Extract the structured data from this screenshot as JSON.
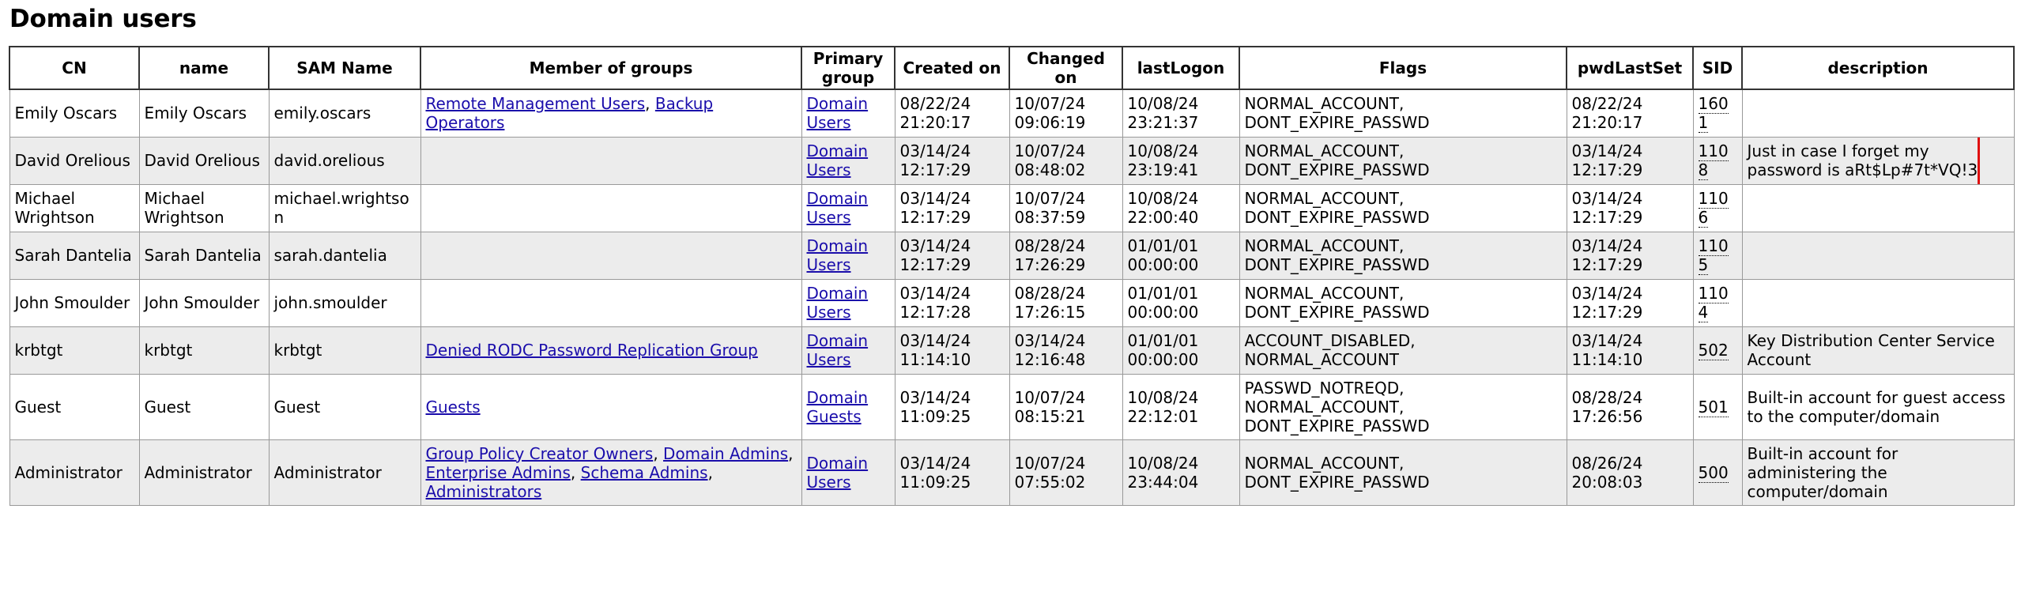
{
  "page": {
    "title": "Domain users"
  },
  "table": {
    "headers": {
      "cn": "CN",
      "name": "name",
      "sam": "SAM Name",
      "groups": "Member of groups",
      "primary": "Primary group",
      "created": "Created on",
      "changed": "Changed on",
      "lastlogon": "lastLogon",
      "flags": "Flags",
      "pwdlastset": "pwdLastSet",
      "sid": "SID",
      "description": "description"
    },
    "rows": [
      {
        "cn": "Emily Oscars",
        "name": "Emily Oscars",
        "sam": "emily.oscars",
        "groups": [
          "Remote Management Users",
          "Backup Operators"
        ],
        "primary": "Domain Users",
        "created": "08/22/24\n21:20:17",
        "changed": "10/07/24\n09:06:19",
        "lastlogon": "10/08/24\n23:21:37",
        "flags": "NORMAL_ACCOUNT,\nDONT_EXPIRE_PASSWD",
        "pwdlastset": "08/22/24\n21:20:17",
        "sid": "1601",
        "description": ""
      },
      {
        "cn": "David Orelious",
        "name": "David Orelious",
        "sam": "david.orelious",
        "groups": [],
        "primary": "Domain Users",
        "created": "03/14/24\n12:17:29",
        "changed": "10/07/24\n08:48:02",
        "lastlogon": "10/08/24\n23:19:41",
        "flags": "NORMAL_ACCOUNT,\nDONT_EXPIRE_PASSWD",
        "pwdlastset": "03/14/24\n12:17:29",
        "sid": "1108",
        "description": "Just in case I forget my password is aRt$Lp#7t*VQ!3"
      },
      {
        "cn": "Michael Wrightson",
        "name": "Michael Wrightson",
        "sam": "michael.wrightson",
        "groups": [],
        "primary": "Domain Users",
        "created": "03/14/24\n12:17:29",
        "changed": "10/07/24\n08:37:59",
        "lastlogon": "10/08/24\n22:00:40",
        "flags": "NORMAL_ACCOUNT,\nDONT_EXPIRE_PASSWD",
        "pwdlastset": "03/14/24\n12:17:29",
        "sid": "1106",
        "description": ""
      },
      {
        "cn": "Sarah Dantelia",
        "name": "Sarah Dantelia",
        "sam": "sarah.dantelia",
        "groups": [],
        "primary": "Domain Users",
        "created": "03/14/24\n12:17:29",
        "changed": "08/28/24\n17:26:29",
        "lastlogon": "01/01/01\n00:00:00",
        "flags": "NORMAL_ACCOUNT,\nDONT_EXPIRE_PASSWD",
        "pwdlastset": "03/14/24\n12:17:29",
        "sid": "1105",
        "description": ""
      },
      {
        "cn": "John Smoulder",
        "name": "John Smoulder",
        "sam": "john.smoulder",
        "groups": [],
        "primary": "Domain Users",
        "created": "03/14/24\n12:17:28",
        "changed": "08/28/24\n17:26:15",
        "lastlogon": "01/01/01\n00:00:00",
        "flags": "NORMAL_ACCOUNT,\nDONT_EXPIRE_PASSWD",
        "pwdlastset": "03/14/24\n12:17:29",
        "sid": "1104",
        "description": ""
      },
      {
        "cn": "krbtgt",
        "name": "krbtgt",
        "sam": "krbtgt",
        "groups": [
          "Denied RODC Password Replication Group"
        ],
        "primary": "Domain Users",
        "created": "03/14/24\n11:14:10",
        "changed": "03/14/24\n12:16:48",
        "lastlogon": "01/01/01\n00:00:00",
        "flags": "ACCOUNT_DISABLED,\nNORMAL_ACCOUNT",
        "pwdlastset": "03/14/24\n11:14:10",
        "sid": "502",
        "description": "Key Distribution Center Service Account"
      },
      {
        "cn": "Guest",
        "name": "Guest",
        "sam": "Guest",
        "groups": [
          "Guests"
        ],
        "primary": "Domain Guests",
        "created": "03/14/24\n11:09:25",
        "changed": "10/07/24\n08:15:21",
        "lastlogon": "10/08/24\n22:12:01",
        "flags": "PASSWD_NOTREQD,\nNORMAL_ACCOUNT,\nDONT_EXPIRE_PASSWD",
        "pwdlastset": "08/28/24\n17:26:56",
        "sid": "501",
        "description": "Built-in account for guest access to the computer/domain"
      },
      {
        "cn": "Administrator",
        "name": "Administrator",
        "sam": "Administrator",
        "groups": [
          "Group Policy Creator Owners",
          "Domain Admins",
          "Enterprise Admins",
          "Schema Admins",
          "Administrators"
        ],
        "primary": "Domain Users",
        "created": "03/14/24\n11:09:25",
        "changed": "10/07/24\n07:55:02",
        "lastlogon": "10/08/24\n23:44:04",
        "flags": "NORMAL_ACCOUNT,\nDONT_EXPIRE_PASSWD",
        "pwdlastset": "08/26/24\n20:08:03",
        "sid": "500",
        "description": "Built-in account for administering the computer/domain"
      }
    ]
  },
  "colors": {
    "link": "#1a0dab",
    "row_alt": "#ececec",
    "highlight": "#e01010"
  }
}
